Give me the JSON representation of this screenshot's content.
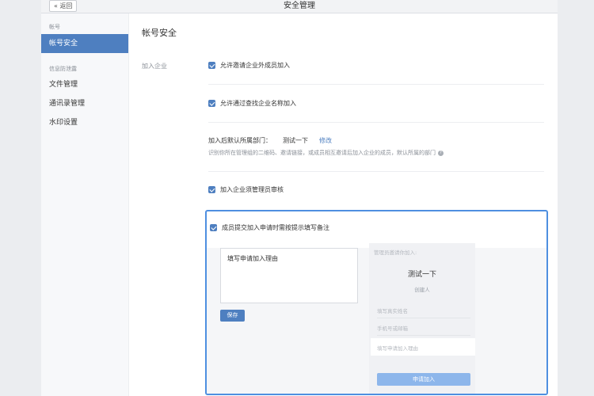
{
  "window": {
    "title": "安全管理",
    "back_label": "« 返回"
  },
  "sidebar": {
    "group_account": "帐号",
    "item_account_security": "帐号安全",
    "group_info": "信息防泄露",
    "item_file_mgmt": "文件管理",
    "item_contacts_mgmt": "通讯录管理",
    "item_watermark": "水印设置"
  },
  "main": {
    "page_title": "帐号安全",
    "section_label": "加入企业",
    "options": {
      "allow_invite": "允许邀请企业外成员加入",
      "allow_search": "允许通过查找企业名称加入",
      "require_approval": "加入企业须管理员审核",
      "require_remark": "成员提交加入申请时需按提示填写备注"
    },
    "dept": {
      "label": "加入后默认所属部门：",
      "value": "测试一下",
      "edit": "修改",
      "hint": "识别你所在管理组的二维码、邀请链接，或成员相互邀请后加入企业的成员，默认所属的部门"
    },
    "reason": {
      "text": "填写申请加入理由",
      "save": "保存"
    },
    "preview": {
      "header": "管理员邀请你加入:",
      "org": "测试一下",
      "role": "创建人",
      "name_field": "填写真实姓名",
      "phone_field": "手机号或邮箱",
      "reason_field": "填写申请加入理由",
      "apply_button": "申请加入"
    }
  },
  "colors": {
    "accent": "#4e7fc0",
    "highlight_border": "#4e8fe0"
  }
}
